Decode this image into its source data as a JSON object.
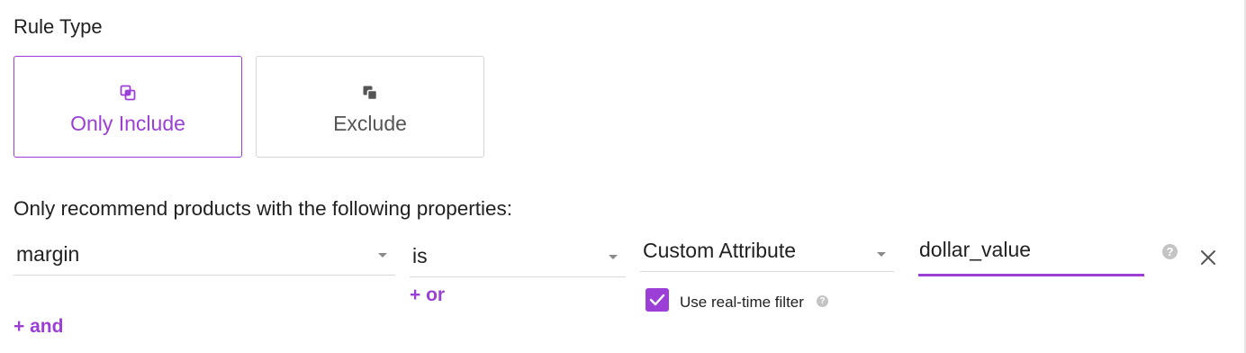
{
  "rule_type": {
    "title": "Rule Type",
    "options": [
      {
        "label": "Only Include",
        "icon": "include-icon",
        "selected": true
      },
      {
        "label": "Exclude",
        "icon": "exclude-icon",
        "selected": false
      }
    ]
  },
  "filter": {
    "heading": "Only recommend products with the following properties:",
    "property_value": "margin",
    "operator_value": "is",
    "source_value": "Custom Attribute",
    "attribute_value": "dollar_value",
    "add_or_label": "+ or",
    "add_and_label": "+ and",
    "realtime_label": "Use real-time filter",
    "realtime_checked": true,
    "help_icon": "question-icon",
    "remove_icon": "close-icon"
  },
  "colors": {
    "accent": "#9b3fd6",
    "text": "#212121",
    "muted": "#555555",
    "border": "#d6d6d6"
  }
}
